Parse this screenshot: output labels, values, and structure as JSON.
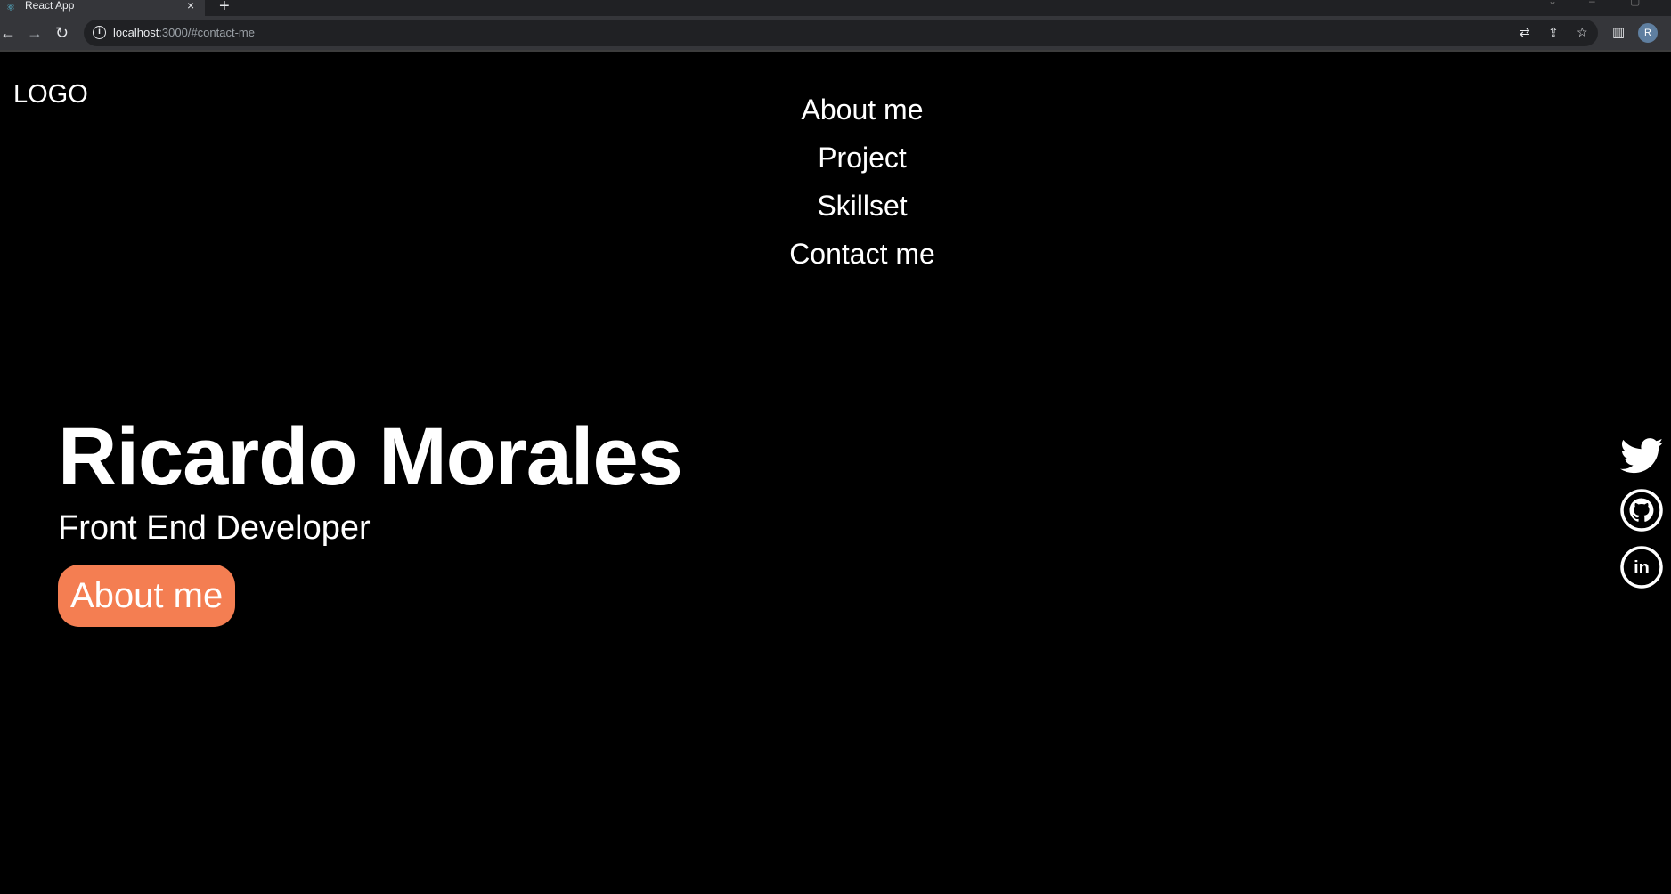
{
  "browser": {
    "tab_title": "React App",
    "tab_close": "×",
    "new_tab": "+",
    "back": "←",
    "forward": "→",
    "reload": "↻",
    "url_host": "localhost",
    "url_rest": ":3000/#contact-me",
    "avatar_initial": "R"
  },
  "page": {
    "logo": "LOGO",
    "nav": [
      "About me",
      "Project",
      "Skillset",
      "Contact me"
    ],
    "hero": {
      "name": "Ricardo Morales",
      "role": "Front End Developer",
      "button": "About me"
    },
    "social_icons": [
      "twitter-icon",
      "github-icon",
      "linkedin-icon"
    ],
    "linkedin_text": "in"
  },
  "colors": {
    "background": "#000000",
    "accent": "#f47e52",
    "text": "#ffffff"
  }
}
